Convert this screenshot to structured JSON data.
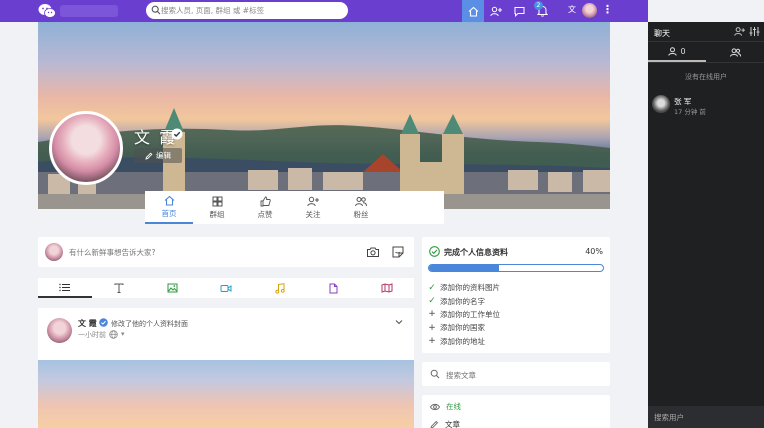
{
  "colors": {
    "topbar": "#6a3fd0",
    "accent": "#4a86d9",
    "success": "#2e9a41",
    "chat_bg": "#1f2022"
  },
  "topbar": {
    "search_placeholder": "搜索人员, 页面, 群组 或 #标签",
    "notifications_badge": "2",
    "user_initial": "文",
    "icons": [
      "home-icon",
      "add-user-icon",
      "messages-icon",
      "notifications-icon",
      "more-icon"
    ]
  },
  "profile": {
    "name": "文 霞",
    "edit_label": "编辑",
    "tabs": [
      {
        "label": "首页",
        "icon": "home-icon"
      },
      {
        "label": "群组",
        "icon": "groups-icon"
      },
      {
        "label": "点赞",
        "icon": "like-icon"
      },
      {
        "label": "关注",
        "icon": "follow-icon"
      },
      {
        "label": "粉丝",
        "icon": "fans-icon"
      }
    ]
  },
  "composer": {
    "prompt": "有什么新鲜事想告诉大家?",
    "types": [
      "list-icon",
      "text-icon",
      "image-icon",
      "video-icon",
      "music-icon",
      "file-icon",
      "map-icon"
    ]
  },
  "post": {
    "author": "文 霞",
    "action": "修改了他的个人资料封面",
    "time": "一小时前"
  },
  "profile_completion": {
    "title": "完成个人信息资料",
    "percent_label": "40%",
    "progress": 0.4,
    "items": [
      {
        "label": "添加你的资料图片",
        "done": true
      },
      {
        "label": "添加你的名字",
        "done": true
      },
      {
        "label": "添加你的工作单位",
        "done": false
      },
      {
        "label": "添加你的国家",
        "done": false
      },
      {
        "label": "添加你的地址",
        "done": false
      }
    ]
  },
  "search_articles": {
    "label": "搜索文章"
  },
  "links": {
    "online": "在线",
    "articles": "文章"
  },
  "chat": {
    "title": "聊天",
    "online_count": "0",
    "empty_text": "没有在线用户",
    "users": [
      {
        "name": "张 军",
        "time": "17 分钟 前"
      }
    ],
    "search_placeholder": "搜索用户"
  }
}
